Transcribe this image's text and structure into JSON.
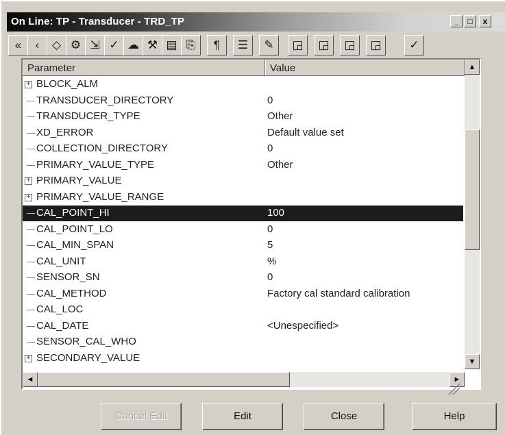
{
  "window": {
    "title": "On Line: TP - Transducer - TRD_TP",
    "min_glyph": "_",
    "max_glyph": "□",
    "close_glyph": "x"
  },
  "toolbar": {
    "items": [
      {
        "name": "first-icon",
        "glyph": "«"
      },
      {
        "name": "back-icon",
        "glyph": "‹"
      },
      {
        "name": "diamond-icon",
        "glyph": "◇"
      },
      {
        "name": "gear-icon",
        "glyph": "⚙"
      },
      {
        "name": "export-icon",
        "glyph": "⇲"
      },
      {
        "name": "check-mark-icon",
        "glyph": "✓"
      },
      {
        "name": "cloud-icon",
        "glyph": "☁"
      },
      {
        "name": "wrench-icon",
        "glyph": "⚒"
      },
      {
        "name": "window-icon",
        "glyph": "▤"
      },
      {
        "name": "document-icon",
        "glyph": "⎘"
      },
      {
        "name": "text-icon",
        "glyph": "¶"
      },
      {
        "name": "list-icon",
        "glyph": "☰"
      },
      {
        "name": "pencil-icon",
        "glyph": "✎"
      },
      {
        "name": "tag-icon-1",
        "glyph": "◲"
      },
      {
        "name": "tag-icon-2",
        "glyph": "◲"
      },
      {
        "name": "tag-icon-3",
        "glyph": "◲"
      },
      {
        "name": "tag-icon-4",
        "glyph": "◲"
      },
      {
        "name": "apply-check-icon",
        "glyph": "✓"
      }
    ]
  },
  "grid": {
    "col_param": "Parameter",
    "col_value": "Value",
    "rows": [
      {
        "param": "BLOCK_ALM",
        "value": "",
        "expand": true
      },
      {
        "param": "TRANSDUCER_DIRECTORY",
        "value": "0",
        "expand": false
      },
      {
        "param": "TRANSDUCER_TYPE",
        "value": "Other",
        "expand": false
      },
      {
        "param": "XD_ERROR",
        "value": "Default value set",
        "expand": false
      },
      {
        "param": "COLLECTION_DIRECTORY",
        "value": "0",
        "expand": false
      },
      {
        "param": "PRIMARY_VALUE_TYPE",
        "value": "Other",
        "expand": false
      },
      {
        "param": "PRIMARY_VALUE",
        "value": "",
        "expand": true
      },
      {
        "param": "PRIMARY_VALUE_RANGE",
        "value": "",
        "expand": true
      },
      {
        "param": "CAL_POINT_HI",
        "value": "100",
        "expand": false,
        "selected": true
      },
      {
        "param": "CAL_POINT_LO",
        "value": "0",
        "expand": false
      },
      {
        "param": "CAL_MIN_SPAN",
        "value": "5",
        "expand": false
      },
      {
        "param": "CAL_UNIT",
        "value": "%",
        "expand": false
      },
      {
        "param": "SENSOR_SN",
        "value": "0",
        "expand": false
      },
      {
        "param": "CAL_METHOD",
        "value": "Factory cal standard calibration",
        "expand": false
      },
      {
        "param": "CAL_LOC",
        "value": "",
        "expand": false
      },
      {
        "param": "CAL_DATE",
        "value": "<Unespecified>",
        "expand": false
      },
      {
        "param": "SENSOR_CAL_WHO",
        "value": "",
        "expand": false
      },
      {
        "param": "SECONDARY_VALUE",
        "value": "",
        "expand": true
      }
    ]
  },
  "buttons": {
    "cancel_edit": "Cancel Edit",
    "edit": "Edit",
    "close": "Close",
    "help": "Help"
  },
  "colors": {
    "selection": "#1c1c1c",
    "face": "#d4d0c8"
  }
}
